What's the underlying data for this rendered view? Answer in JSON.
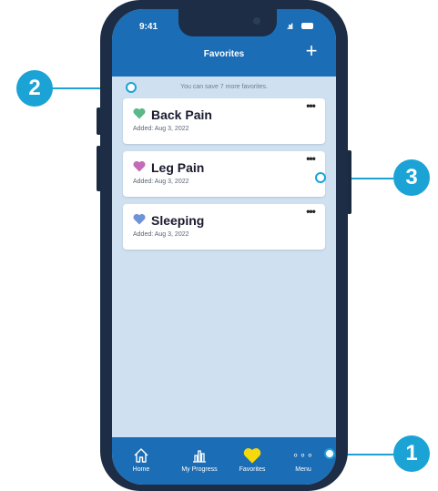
{
  "status_bar": {
    "time": "9:41",
    "signal": ".ııl"
  },
  "header": {
    "title": "Favorites",
    "add_label": "+"
  },
  "notice": "You can save 7 more favorites.",
  "favorites": [
    {
      "name": "Back Pain",
      "added": "Added: Aug 3, 2022",
      "heart_color": "#5bb88a",
      "more": "•••"
    },
    {
      "name": "Leg Pain",
      "added": "Added: Aug 3, 2022",
      "heart_color": "#c46bb8",
      "more": "•••"
    },
    {
      "name": "Sleeping",
      "added": "Added: Aug 3, 2022",
      "heart_color": "#6e93d6",
      "more": "•••"
    }
  ],
  "tabbar": {
    "home": "Home",
    "progress": "My Progress",
    "favorites": "Favorites",
    "menu": "Menu",
    "menu_icon": "∘∘∘",
    "active_color": "#f5d90a"
  },
  "callouts": {
    "one": "1",
    "two": "2",
    "three": "3"
  },
  "colors": {
    "header": "#1b6db5",
    "background": "#cfe0f0",
    "callout": "#1ba3d6"
  }
}
